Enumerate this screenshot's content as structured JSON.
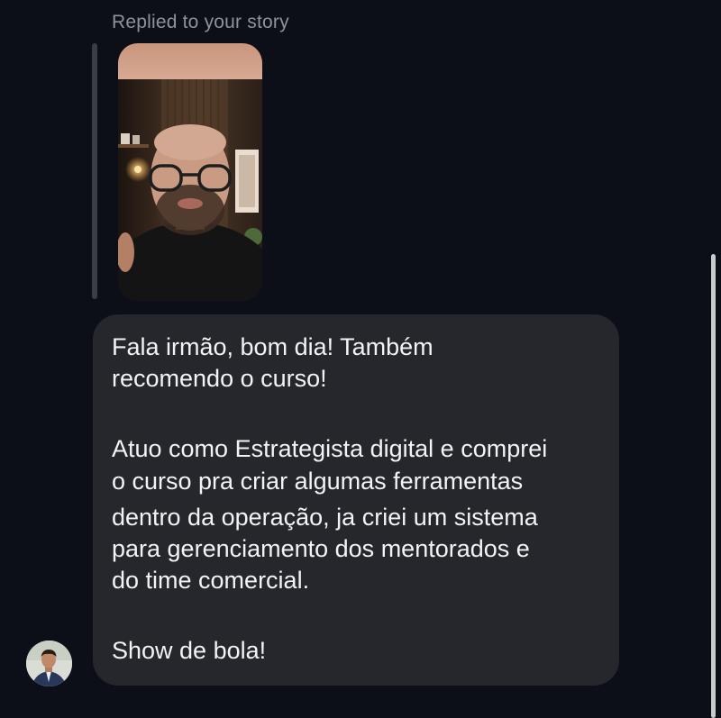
{
  "reply": {
    "label": "Replied to your story"
  },
  "message": {
    "lines": [
      "Fala irmão, bom dia! Também",
      "recomendo o curso!",
      "Atuo como Estrategista digital e comprei",
      "o curso pra criar algumas ferramentas",
      "dentro da operação, ja criei um sistema",
      "para gerenciamento dos mentorados e",
      "do time comercial.",
      "Show de bola!"
    ]
  },
  "colors": {
    "background": "#0c0f17",
    "bubble": "#25272d",
    "text": "#f2f3f5",
    "muted": "#8e929a"
  },
  "icons": {
    "avatar": "sender-avatar",
    "story": "story-thumbnail"
  }
}
